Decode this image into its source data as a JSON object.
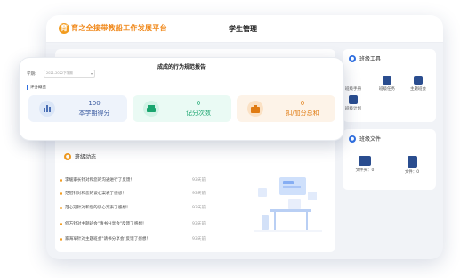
{
  "app": {
    "logo_glyph": "育",
    "logo_text": "育之全接带教船工作发展平台",
    "title": "学生管理"
  },
  "report": {
    "title": "成成的行为规范报告",
    "term_label": "学期:",
    "term_value": "2021-2022下学期",
    "overview_label": "评分概览",
    "stats": [
      {
        "value": "100",
        "label": "本学期得分",
        "icon": "chart-bars-icon"
      },
      {
        "value": "0",
        "label": "记分次数",
        "icon": "printer-icon"
      },
      {
        "value": "0",
        "label": "扣/加分总和",
        "icon": "briefcase-icon"
      }
    ]
  },
  "class_dynamics": {
    "title": "班级动态",
    "items": [
      {
        "text": "李缓家长针对和您的沟通进行了反馈！",
        "time": "93天前"
      },
      {
        "text": "范冠针对和您的谈心案表了感想！",
        "time": "93天前"
      },
      {
        "text": "范心冠针对和您的谈心案表了感想！",
        "time": "93天前"
      },
      {
        "text": "何方针对主题班会\"请书分享会\"反馈了感想！",
        "time": "93天前"
      },
      {
        "text": "家海军针对主题班会\"请书分享会\"反馈了感想！",
        "time": "93天前"
      }
    ]
  },
  "class_tools": {
    "title": "班级工具",
    "items": [
      {
        "label": "班级手册",
        "icon": "handbook-icon"
      },
      {
        "label": "班级任务",
        "icon": "task-icon"
      },
      {
        "label": "主题班会",
        "icon": "meeting-icon"
      },
      {
        "label": "班级计划",
        "icon": "plan-icon"
      }
    ]
  },
  "class_files": {
    "title": "班级文件",
    "items": [
      {
        "label": "文件夹：0",
        "icon": "folder-icon"
      },
      {
        "label": "文件：0",
        "icon": "file-icon"
      }
    ]
  },
  "colors": {
    "accent_orange": "#f29b1d",
    "accent_blue": "#2f6fe0",
    "navy": "#2a4d8f"
  }
}
